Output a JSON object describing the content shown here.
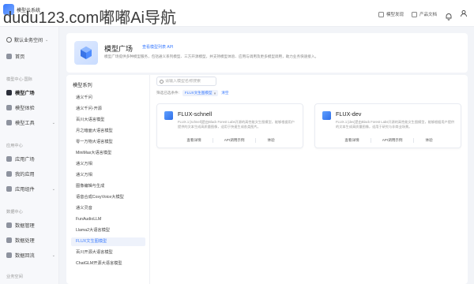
{
  "app": {
    "logo_text": "模型云系统",
    "watermark": "dudu123.com嘟嘟Ai导航"
  },
  "topbar": {
    "doc_label": "模型发现",
    "download_label": "产品文档"
  },
  "sidebar": {
    "workspace": "默认业务空间",
    "home": "首页",
    "section_model": "模型中心·国际",
    "model_plaza": "模型广场",
    "model_experience": "模型体验",
    "model_tools": "模型工具",
    "section_app": "应用中心",
    "app_plaza": "应用广场",
    "my_apps": "我的应用",
    "app_components": "应用组件",
    "section_data": "数据中心",
    "data_manage": "数据管理",
    "data_process": "数据处理",
    "data_backflow": "数据回流",
    "section_model_center": "业务空间"
  },
  "header": {
    "title": "模型广场",
    "badge": "查看模型列表 API",
    "desc": "模型广场提供多种模型服务，包括通义系列模型、三方开源模型，并支持模型体验、应用与调用及更多模型调用，助力业务快速接入。"
  },
  "series": {
    "title": "模型系列",
    "items": [
      "通义千问",
      "通义千问-开源",
      "百川大语言模型",
      "月之暗面大语言模型",
      "零一万物大语言模型",
      "MiniMax大语言模型",
      "通义万相",
      "通义万相",
      "图像编辑与生成",
      "语音合成CosyVoice大模型",
      "通义灵音",
      "FunAudioLLM",
      "Llama2大语言模型",
      "FLUX文生图模型",
      "百川开源大语言模型",
      "ChatGLM开源大语言模型"
    ]
  },
  "search": {
    "placeholder": "请输入模型名称搜索"
  },
  "filter": {
    "label": "筛选已选条件:",
    "chip": "FLUX文生图模型",
    "clear": "清空"
  },
  "cards": [
    {
      "title": "FLUX-schnell",
      "desc": "FLUX.1 [schnell]是由Black Forest Labs开源的高性能文生图模型，能够根据用户提供的文本生成高质量图像，适用于快速生成各类图片。",
      "actions": [
        "查看详情",
        "API调用示例",
        "体验"
      ]
    },
    {
      "title": "FLUX-dev",
      "desc": "FLUX.1 [dev]是由Black Forest Labs开源的高性能文生图模型，能够根据用户提供的文本生成高质量图像，适用于研究与非商业场景。",
      "actions": [
        "查看详情",
        "API调用示例",
        "体验"
      ]
    }
  ],
  "colors": {
    "accent": "#3a7bff",
    "background": "#f2f4f8"
  }
}
